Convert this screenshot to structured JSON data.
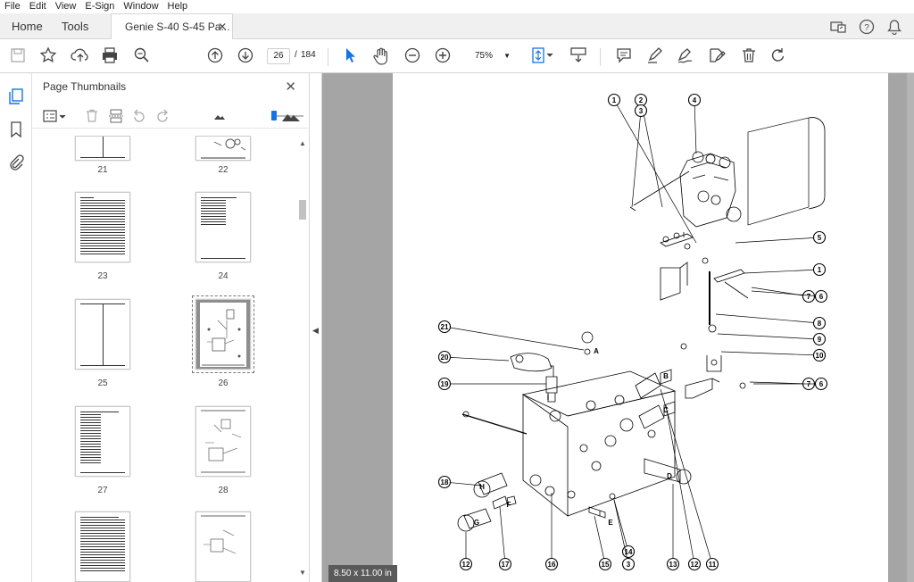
{
  "menu": [
    "File",
    "Edit",
    "View",
    "E-Sign",
    "Window",
    "Help"
  ],
  "tabs": {
    "home": "Home",
    "tools": "Tools",
    "document": "Genie S-40 S-45 Pa..."
  },
  "toolbar": {
    "current_page": "26",
    "page_separator": "/",
    "total_pages": "184",
    "zoom": "75%"
  },
  "panel": {
    "title": "Page Thumbnails",
    "thumbnails": [
      {
        "label": "21"
      },
      {
        "label": "22"
      },
      {
        "label": "23"
      },
      {
        "label": "24"
      },
      {
        "label": "25"
      },
      {
        "label": "26"
      },
      {
        "label": "27"
      },
      {
        "label": "28"
      },
      {
        "label": "",
        "partial": true
      },
      {
        "label": "",
        "partial": true
      }
    ],
    "selected_page": "26"
  },
  "document": {
    "page_size": "8.50 x 11.00 in"
  },
  "diagram": {
    "callouts": [
      "1",
      "2",
      "3",
      "4",
      "5",
      "1",
      "7",
      "6",
      "8",
      "9",
      "10",
      "7",
      "6",
      "21",
      "20",
      "19",
      "18",
      "12",
      "17",
      "16",
      "15",
      "14",
      "3",
      "13",
      "12",
      "11"
    ],
    "ports": [
      "A",
      "B",
      "C",
      "D",
      "E",
      "F",
      "G",
      "H",
      "I"
    ]
  },
  "colors": {
    "accent": "#1473e6",
    "doc_bg": "#a5a5a5",
    "chrome": "#f0f0f0"
  }
}
